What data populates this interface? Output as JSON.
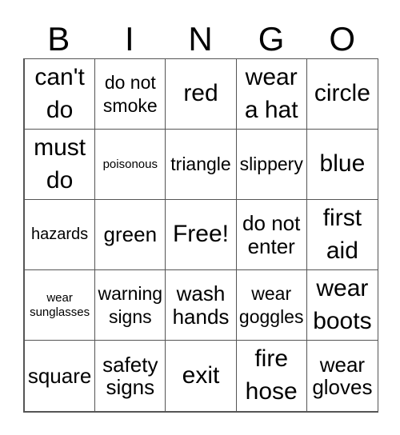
{
  "header": [
    "B",
    "I",
    "N",
    "G",
    "O"
  ],
  "cells": [
    {
      "text": "can't do",
      "size": "s30"
    },
    {
      "text": "do not smoke",
      "size": "s23"
    },
    {
      "text": "red",
      "size": "s30"
    },
    {
      "text": "wear a hat",
      "size": "s30"
    },
    {
      "text": "circle",
      "size": "s30"
    },
    {
      "text": "must do",
      "size": "s30"
    },
    {
      "text": "poisonous",
      "size": "s15"
    },
    {
      "text": "triangle",
      "size": "s23"
    },
    {
      "text": "slippery",
      "size": "s23"
    },
    {
      "text": "blue",
      "size": "s30"
    },
    {
      "text": "hazards",
      "size": "s19"
    },
    {
      "text": "green",
      "size": "s26"
    },
    {
      "text": "Free!",
      "size": "s30"
    },
    {
      "text": "do not enter",
      "size": "s26"
    },
    {
      "text": "first aid",
      "size": "s30"
    },
    {
      "text": "wear sunglasses",
      "size": "s15"
    },
    {
      "text": "warning signs",
      "size": "s23"
    },
    {
      "text": "wash hands",
      "size": "s26"
    },
    {
      "text": "wear goggles",
      "size": "s23"
    },
    {
      "text": "wear boots",
      "size": "s30"
    },
    {
      "text": "square",
      "size": "s26"
    },
    {
      "text": "safety signs",
      "size": "s26"
    },
    {
      "text": "exit",
      "size": "s30"
    },
    {
      "text": "fire hose",
      "size": "s30"
    },
    {
      "text": "wear gloves",
      "size": "s26"
    }
  ]
}
